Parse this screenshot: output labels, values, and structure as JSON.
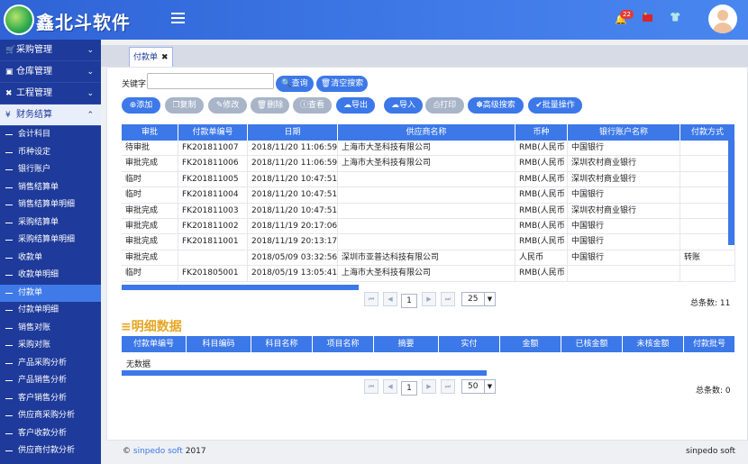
{
  "header": {
    "app_title": "鑫北斗软件",
    "notification_count": "22"
  },
  "sidebar": {
    "groups": [
      {
        "label": "采购管理",
        "icon": "cart-icon"
      },
      {
        "label": "仓库管理",
        "icon": "cube-icon"
      },
      {
        "label": "工程管理",
        "icon": "wrench-icon"
      },
      {
        "label": "财务结算",
        "icon": "money-icon"
      }
    ],
    "items": [
      {
        "label": "会计科目"
      },
      {
        "label": "币种设定"
      },
      {
        "label": "银行账户"
      },
      {
        "label": "销售结算单"
      },
      {
        "label": "销售结算单明细"
      },
      {
        "label": "采购结算单"
      },
      {
        "label": "采购结算单明细"
      },
      {
        "label": "收款单"
      },
      {
        "label": "收款单明细"
      },
      {
        "label": "付款单"
      },
      {
        "label": "付款单明细"
      },
      {
        "label": "销售对账"
      },
      {
        "label": "采购对账"
      },
      {
        "label": "产品采购分析"
      },
      {
        "label": "产品销售分析"
      },
      {
        "label": "客户销售分析"
      },
      {
        "label": "供应商采购分析"
      },
      {
        "label": "客户收款分析"
      },
      {
        "label": "供应商付款分析"
      }
    ]
  },
  "tab": {
    "label": "付款单"
  },
  "search": {
    "keyword_label": "关键字",
    "keyword_value": "",
    "query_label": "查询",
    "clear_label": "清空搜索"
  },
  "toolbar": {
    "add": "添加",
    "copy": "复制",
    "edit": "修改",
    "delete": "删除",
    "view": "查看",
    "export": "导出",
    "import": "导入",
    "print": "打印",
    "advanced": "高级搜索",
    "batch": "批量操作"
  },
  "main_table": {
    "headers": [
      "审批",
      "付款单编号",
      "日期",
      "供应商名称",
      "币种",
      "银行账户名称",
      "付款方式"
    ],
    "rows": [
      [
        "待审批",
        "FK201811007",
        "2018/11/20 11:06:59",
        "上海市大圣科技有限公司",
        "RMB(人民币",
        "中国银行",
        ""
      ],
      [
        "审批完成",
        "FK201811006",
        "2018/11/20 11:06:59",
        "上海市大圣科技有限公司",
        "RMB(人民币",
        "深圳农村商业银行",
        ""
      ],
      [
        "临时",
        "FK201811005",
        "2018/11/20 10:47:51",
        "",
        "RMB(人民币",
        "深圳农村商业银行",
        ""
      ],
      [
        "临时",
        "FK201811004",
        "2018/11/20 10:47:51",
        "",
        "RMB(人民币",
        "中国银行",
        ""
      ],
      [
        "审批完成",
        "FK201811003",
        "2018/11/20 10:47:51",
        "",
        "RMB(人民币",
        "深圳农村商业银行",
        ""
      ],
      [
        "审批完成",
        "FK201811002",
        "2018/11/19 20:17:06",
        "",
        "RMB(人民币",
        "中国银行",
        ""
      ],
      [
        "审批完成",
        "FK201811001",
        "2018/11/19 20:13:17",
        "",
        "RMB(人民币",
        "中国银行",
        ""
      ],
      [
        "审批完成",
        "",
        "2018/05/09 03:32:56",
        "深圳市亚普达科技有限公司",
        "人民币",
        "中国银行",
        "转账"
      ],
      [
        "临时",
        "FK201805001",
        "2018/05/19 13:05:41",
        "上海市大圣科技有限公司",
        "RMB(人民币",
        "",
        ""
      ]
    ],
    "page": "1",
    "page_size": "25",
    "total": "总条数: 11"
  },
  "detail": {
    "title": "明细数据",
    "headers": [
      "付款单编号",
      "科目编码",
      "科目名称",
      "项目名称",
      "摘要",
      "实付",
      "金额",
      "已核金额",
      "未核金额",
      "付款批号"
    ],
    "empty": "无数据",
    "page": "1",
    "page_size": "50",
    "total": "总条数: 0"
  },
  "footer": {
    "copyright": "©",
    "company": "sinpedo soft",
    "year": "2017",
    "right": "sinpedo soft"
  }
}
